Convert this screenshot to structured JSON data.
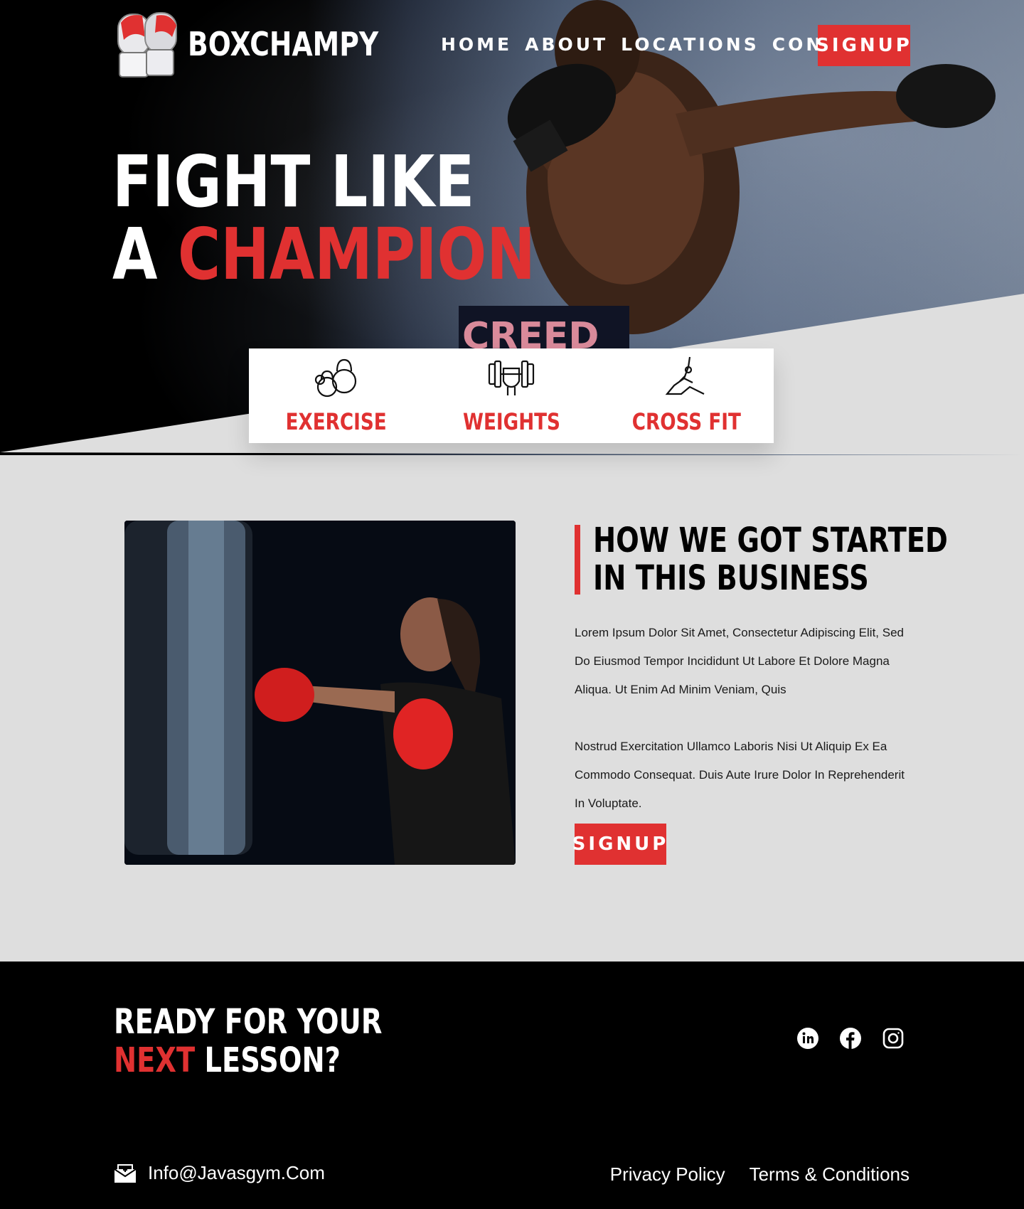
{
  "brand": {
    "name": "BOXCHAMPY",
    "logo_icon": "boxing-gloves-icon"
  },
  "nav": {
    "items": [
      {
        "label": "HOME"
      },
      {
        "label": "ABOUT"
      },
      {
        "label": "LOCATIONS"
      },
      {
        "label": "CONTACT"
      }
    ],
    "signup_label": "SIGNUP"
  },
  "hero": {
    "line1": "FIGHT LIKE",
    "line2_prefix": "A ",
    "line2_highlight": "CHAMPION",
    "image_text": "CREED"
  },
  "features": [
    {
      "label": "EXERCISE",
      "icon": "kettlebell-icon"
    },
    {
      "label": "WEIGHTS",
      "icon": "dumbbell-fist-icon"
    },
    {
      "label": "CROSS FIT",
      "icon": "yoga-stretch-icon"
    }
  ],
  "about": {
    "title_line1": "HOW WE GOT STARTED",
    "title_line2": "IN THIS BUSINESS",
    "paragraph1": "Lorem Ipsum Dolor Sit Amet, Consectetur Adipiscing Elit, Sed Do Eiusmod Tempor Incididunt Ut Labore Et Dolore Magna Aliqua. Ut Enim Ad Minim Veniam, Quis",
    "paragraph2": "Nostrud Exercitation Ullamco Laboris Nisi Ut Aliquip Ex Ea Commodo Consequat. Duis Aute Irure Dolor In Reprehenderit In Voluptate.",
    "signup_label": "SIGNUP"
  },
  "footer": {
    "cta_line1": "READY FOR YOUR",
    "cta_highlight": "NEXT",
    "cta_rest": " LESSON?",
    "social_icons": [
      "linkedin-icon",
      "facebook-icon",
      "instagram-icon"
    ],
    "email": "Info@Javasgym.Com",
    "links": [
      "Privacy Policy",
      "Terms & Conditions"
    ]
  },
  "colors": {
    "accent": "#e03131",
    "background": "#dedede",
    "dark": "#000000"
  }
}
